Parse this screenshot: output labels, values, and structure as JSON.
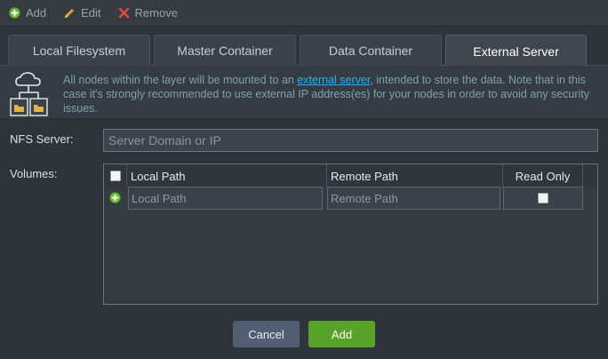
{
  "toolbar": {
    "add_label": "Add",
    "edit_label": "Edit",
    "remove_label": "Remove"
  },
  "tabs": [
    {
      "label": "Local Filesystem",
      "active": false
    },
    {
      "label": "Master Container",
      "active": false
    },
    {
      "label": "Data Container",
      "active": false
    },
    {
      "label": "External Server",
      "active": true
    }
  ],
  "info": {
    "text_before": "All nodes within the layer will be mounted to an ",
    "link": "external server",
    "text_after": ", intended to store the data. Note that in this case it's strongly recommended to use external IP address(es) for your nodes in order to avoid any security issues."
  },
  "form": {
    "nfs_label": "NFS Server:",
    "nfs_placeholder": "Server Domain or IP",
    "volumes_label": "Volumes:"
  },
  "grid": {
    "headers": [
      "Local Path",
      "Remote Path",
      "Read Only"
    ],
    "row": {
      "local_placeholder": "Local Path",
      "remote_placeholder": "Remote Path",
      "read_only": false
    }
  },
  "buttons": {
    "cancel": "Cancel",
    "add": "Add"
  },
  "colors": {
    "accent_link": "#27b1ff",
    "add_button": "#57a329",
    "cancel_button": "#525e74",
    "remove_icon": "#e04a3a",
    "add_icon": "#6fbf3a"
  }
}
